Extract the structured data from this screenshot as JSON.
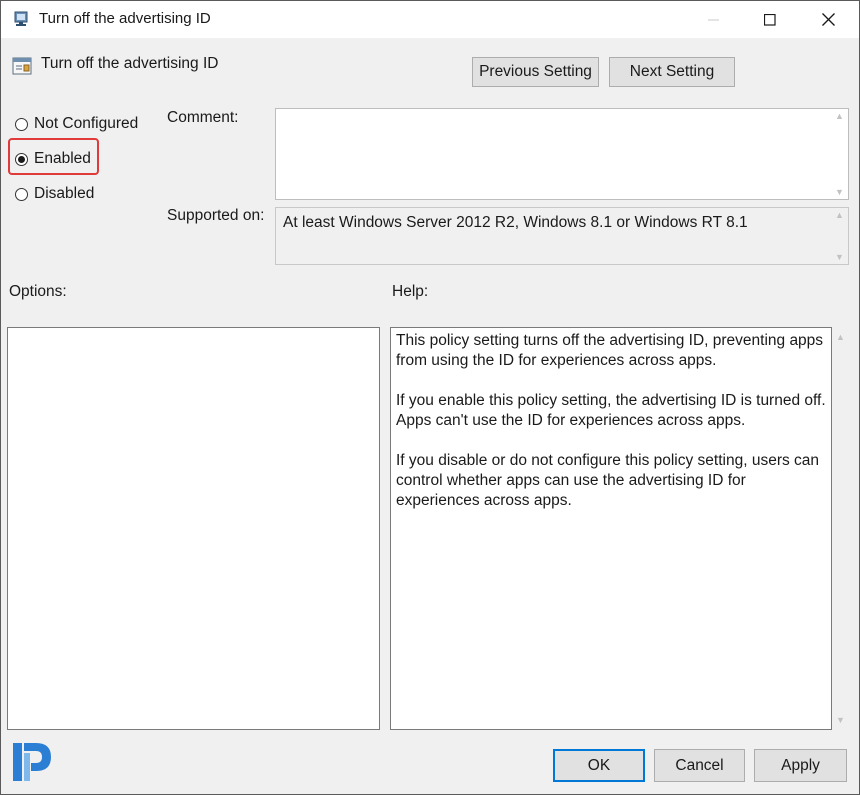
{
  "window": {
    "title": "Turn off the advertising ID",
    "icons": {
      "app": "policy-icon",
      "minimize": "minimize-icon",
      "maximize": "maximize-icon",
      "close": "close-icon"
    }
  },
  "header": {
    "title": "Turn off the advertising ID",
    "icon": "policy-setting-icon"
  },
  "nav": {
    "previous_label": "Previous Setting",
    "next_label": "Next Setting"
  },
  "state": {
    "options": [
      {
        "label": "Not Configured",
        "checked": false
      },
      {
        "label": "Enabled",
        "checked": true
      },
      {
        "label": "Disabled",
        "checked": false
      }
    ],
    "highlight_color": "#e03a3a"
  },
  "comment": {
    "label": "Comment:",
    "value": ""
  },
  "supported": {
    "label": "Supported on:",
    "value": "At least Windows Server 2012 R2, Windows 8.1 or Windows RT 8.1"
  },
  "options_panel": {
    "label": "Options:"
  },
  "help_panel": {
    "label": "Help:",
    "paragraphs": [
      "This policy setting turns off the advertising ID, preventing apps from using the ID for experiences across apps.",
      "If you enable this policy setting, the advertising ID is turned off. Apps can't use the ID for experiences across apps.",
      "If you disable or do not configure this policy setting, users can control whether apps can use the advertising ID for experiences across apps."
    ]
  },
  "footer": {
    "ok_label": "OK",
    "cancel_label": "Cancel",
    "apply_label": "Apply",
    "logo_icon": "brand-logo-icon"
  },
  "colors": {
    "accent": "#0078d7",
    "dialog_bg": "#f0f0f0",
    "logo": "#2a7fd4"
  }
}
